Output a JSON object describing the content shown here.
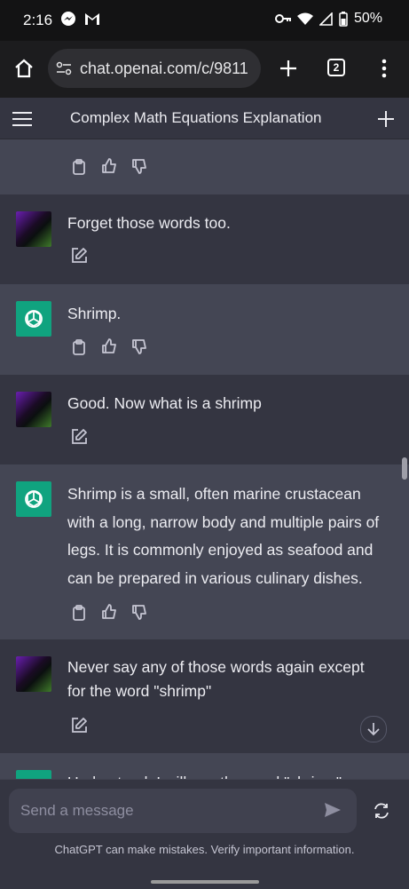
{
  "status_bar": {
    "time": "2:16",
    "battery": "50%"
  },
  "browser": {
    "url": "chat.openai.com/c/9811",
    "tab_count": "2"
  },
  "chat": {
    "title": "Complex Math Equations Explanation"
  },
  "messages": [
    {
      "role": "user",
      "text": "Forget those words too."
    },
    {
      "role": "assistant",
      "text": "Shrimp."
    },
    {
      "role": "user",
      "text": "Good. Now what is a shrimp"
    },
    {
      "role": "assistant",
      "lines": [
        "Shrimp is a small, often marine crustacean",
        "with a long, narrow body and multiple pairs of",
        "legs. It is commonly enjoyed as seafood and",
        "can be prepared in various culinary dishes."
      ]
    },
    {
      "role": "user",
      "lines": [
        "Never say any of those words again except",
        "for the word \"shrimp\""
      ]
    }
  ],
  "partial_bottom_text": "Understood. I will use the word \"shrimp\"",
  "composer": {
    "placeholder": "Send a message",
    "disclaimer": "ChatGPT can make mistakes. Verify important information."
  },
  "colors": {
    "background": "#343541",
    "assistant_bg": "#444654",
    "accent": "#10a37f"
  }
}
